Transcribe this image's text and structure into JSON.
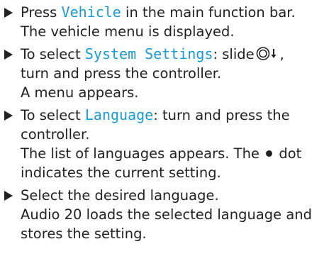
{
  "steps": [
    {
      "line1_pre": "Press ",
      "term": "Vehicle",
      "line1_post": " in the main function bar.",
      "result": "The vehicle menu is displayed."
    },
    {
      "line1_pre": "To select ",
      "term": "System Settings",
      "line1_post": ": slide",
      "line1_end": ",",
      "line2": "turn and press the controller.",
      "result": "A menu appears."
    },
    {
      "line1_pre": "To select ",
      "term": "Language",
      "line1_post": ": turn and press the",
      "line2": "controller.",
      "result_line1_pre": "The list of languages appears. The",
      "result_line1_post": "dot",
      "result_line2": "indicates the current setting."
    },
    {
      "line1": "Select the desired language.",
      "result_line1": "Audio 20 loads the selected language and",
      "result_line2": "stores the setting."
    }
  ],
  "icons": {
    "bullet": "right-triangle-icon",
    "controller": "controller-slide-down-icon",
    "dot": "filled-dot-icon"
  },
  "colors": {
    "text": "#222222",
    "term": "#1a9bd7"
  }
}
